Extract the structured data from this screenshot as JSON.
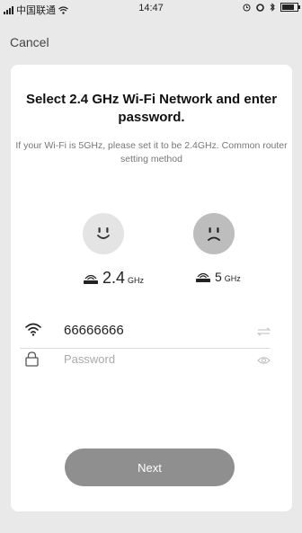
{
  "status_bar": {
    "carrier": "中国联通",
    "time": "14:47"
  },
  "nav": {
    "cancel_label": "Cancel"
  },
  "content": {
    "title": "Select 2.4 GHz Wi-Fi Network and enter password.",
    "hint": "If your Wi-Fi is 5GHz, please set it to be 2.4GHz. Common router setting method",
    "bands": [
      {
        "number": "2.4",
        "unit": "GHz",
        "face": "smile-icon"
      },
      {
        "number": "5",
        "unit": "GHz",
        "face": "frown-icon"
      }
    ],
    "ssid": {
      "value": "66666666"
    },
    "password": {
      "placeholder": "Password",
      "value": ""
    },
    "next_label": "Next"
  }
}
